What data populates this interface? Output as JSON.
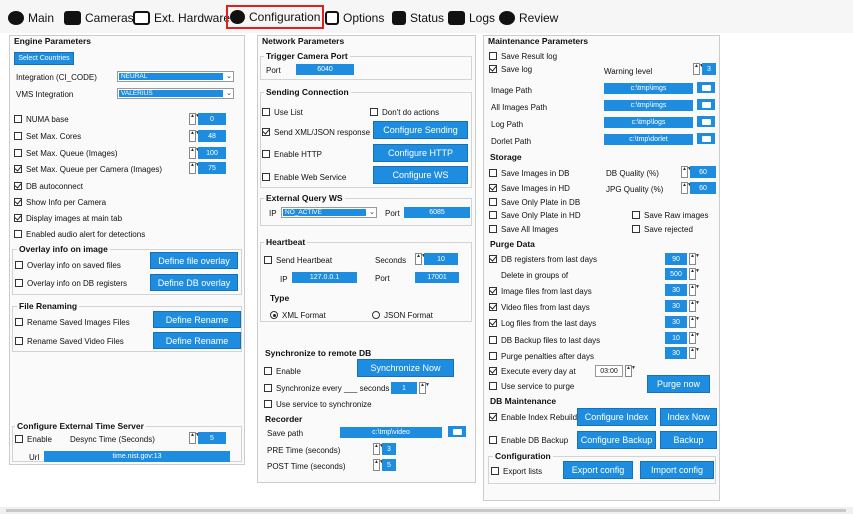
{
  "tabs": [
    "Main",
    "Cameras",
    "Ext. Hardware",
    "Configuration",
    "Options",
    "Status",
    "Logs",
    "Review"
  ],
  "engine": {
    "title": "Engine Parameters",
    "select_countries": "Select Countries",
    "integration_label": "Integration (CI_CODE)",
    "integration_value": "NEURAL",
    "vms_label": "VMS Integration",
    "vms_value": "VALERIUS",
    "numa_label": "NUMA base",
    "numa_value": "0",
    "max_cores_label": "Set Max. Cores",
    "max_cores_value": "48",
    "max_queue_label": "Set Max. Queue (Images)",
    "max_queue_value": "100",
    "max_queue_cam_label": "Set Max. Queue per Camera (Images)",
    "max_queue_cam_value": "75",
    "db_autoconnect": "DB autoconnect",
    "show_info": "Show Info per Camera",
    "display_images": "Display images at main tab",
    "audio_alert": "Enabled audio alert for detections",
    "overlay_title": "Overlay info on image",
    "overlay_saved": "Overlay info on saved files",
    "overlay_db": "Overlay info on DB registers",
    "define_file_overlay": "Define file overlay",
    "define_db_overlay": "Define DB overlay",
    "renaming_title": "File Renaming",
    "rename_images": "Rename Saved Images Files",
    "rename_video": "Rename Saved Video Files",
    "define_rename": "Define Rename",
    "time_title": "Configure External Time Server",
    "time_enable": "Enable",
    "desync_label": "Desync Time (Seconds)",
    "desync_value": "5",
    "url_label": "Url",
    "url_value": "time.nist.gov:13"
  },
  "network": {
    "title": "Network Parameters",
    "trigger_title": "Trigger Camera Port",
    "port_label": "Port",
    "port_value": "6040",
    "sending_title": "Sending Connection",
    "use_list": "Use List",
    "dont_do": "Don't do actions",
    "send_xml": "Send XML/JSON response",
    "configure_sending": "Configure Sending",
    "enable_http": "Enable HTTP",
    "configure_http": "Configure HTTP",
    "enable_ws": "Enable Web Service",
    "configure_ws": "Configure WS",
    "ext_query_title": "External Query WS",
    "ip_label": "IP",
    "ip_value": "NO_ACTIVE",
    "port2_label": "Port",
    "port2_value": "6085",
    "heartbeat_title": "Heartbeat",
    "send_heartbeat": "Send Heartbeat",
    "seconds_label": "Seconds",
    "seconds_value": "10",
    "hb_ip_label": "IP",
    "hb_ip_value": "127.0.0.1",
    "hb_port_label": "Port",
    "hb_port_value": "17001",
    "type_title": "Type",
    "xml_format": "XML Format",
    "json_format": "JSON Format",
    "sync_title": "Synchronize to remote DB",
    "sync_enable": "Enable",
    "sync_now": "Synchronize Now",
    "sync_every": "Synchronize every ___ seconds",
    "sync_every_value": "1",
    "use_service": "Use service to synchronize",
    "recorder_title": "Recorder",
    "save_path_label": "Save path",
    "save_path_value": "c:\\tmp\\video",
    "pre_time_label": "PRE Time (seconds)",
    "pre_time_value": "3",
    "post_time_label": "POST Time (seconds)",
    "post_time_value": "5"
  },
  "maintenance": {
    "title": "Maintenance Parameters",
    "save_result_log": "Save Result log",
    "save_log": "Save log",
    "warning_label": "Warning level",
    "warning_value": "3",
    "image_path_label": "Image Path",
    "image_path_value": "c:\\tmp\\imgs",
    "all_images_label": "All Images Path",
    "all_images_value": "c:\\tmp\\imgs",
    "log_path_label": "Log Path",
    "log_path_value": "c:\\tmp\\logs",
    "dorlet_label": "Dorlet Path",
    "dorlet_value": "c:\\tmp\\dorlet",
    "storage_title": "Storage",
    "save_images_db": "Save Images in DB",
    "save_images_hd": "Save Images in HD",
    "db_quality_label": "DB Quality (%)",
    "db_quality_value": "60",
    "jpg_quality_label": "JPG Quality (%)",
    "jpg_quality_value": "60",
    "save_only_plate_db": "Save Only Plate in DB",
    "save_only_plate_hd": "Save Only Plate in HD",
    "save_raw": "Save Raw images",
    "save_all": "Save All Images",
    "save_rejected": "Save rejected",
    "purge_title": "Purge Data",
    "db_registers": "DB registers from last days",
    "db_registers_value": "90",
    "delete_groups": "Delete in groups of",
    "delete_groups_value": "500",
    "image_files": "Image files from last days",
    "image_files_value": "30",
    "video_files": "Video files from last days",
    "video_files_value": "30",
    "log_files": "Log files from the last days",
    "log_files_value": "30",
    "db_backup": "DB Backup files to last days",
    "db_backup_value": "10",
    "purge_penalties": "Purge penalties after days",
    "purge_penalties_value": "30",
    "execute_every": "Execute every day at",
    "execute_value": "03:00",
    "use_service_purge": "Use service to purge",
    "purge_now": "Purge now",
    "dbm_title": "DB Maintenance",
    "enable_index": "Enable Index Rebuild",
    "configure_index": "Configure Index",
    "index_now": "Index Now",
    "enable_backup": "Enable DB Backup",
    "configure_backup": "Configure Backup",
    "backup": "Backup",
    "config_title": "Configuration",
    "export_lists": "Export lists",
    "export_config": "Export config",
    "import_config": "Import config"
  }
}
